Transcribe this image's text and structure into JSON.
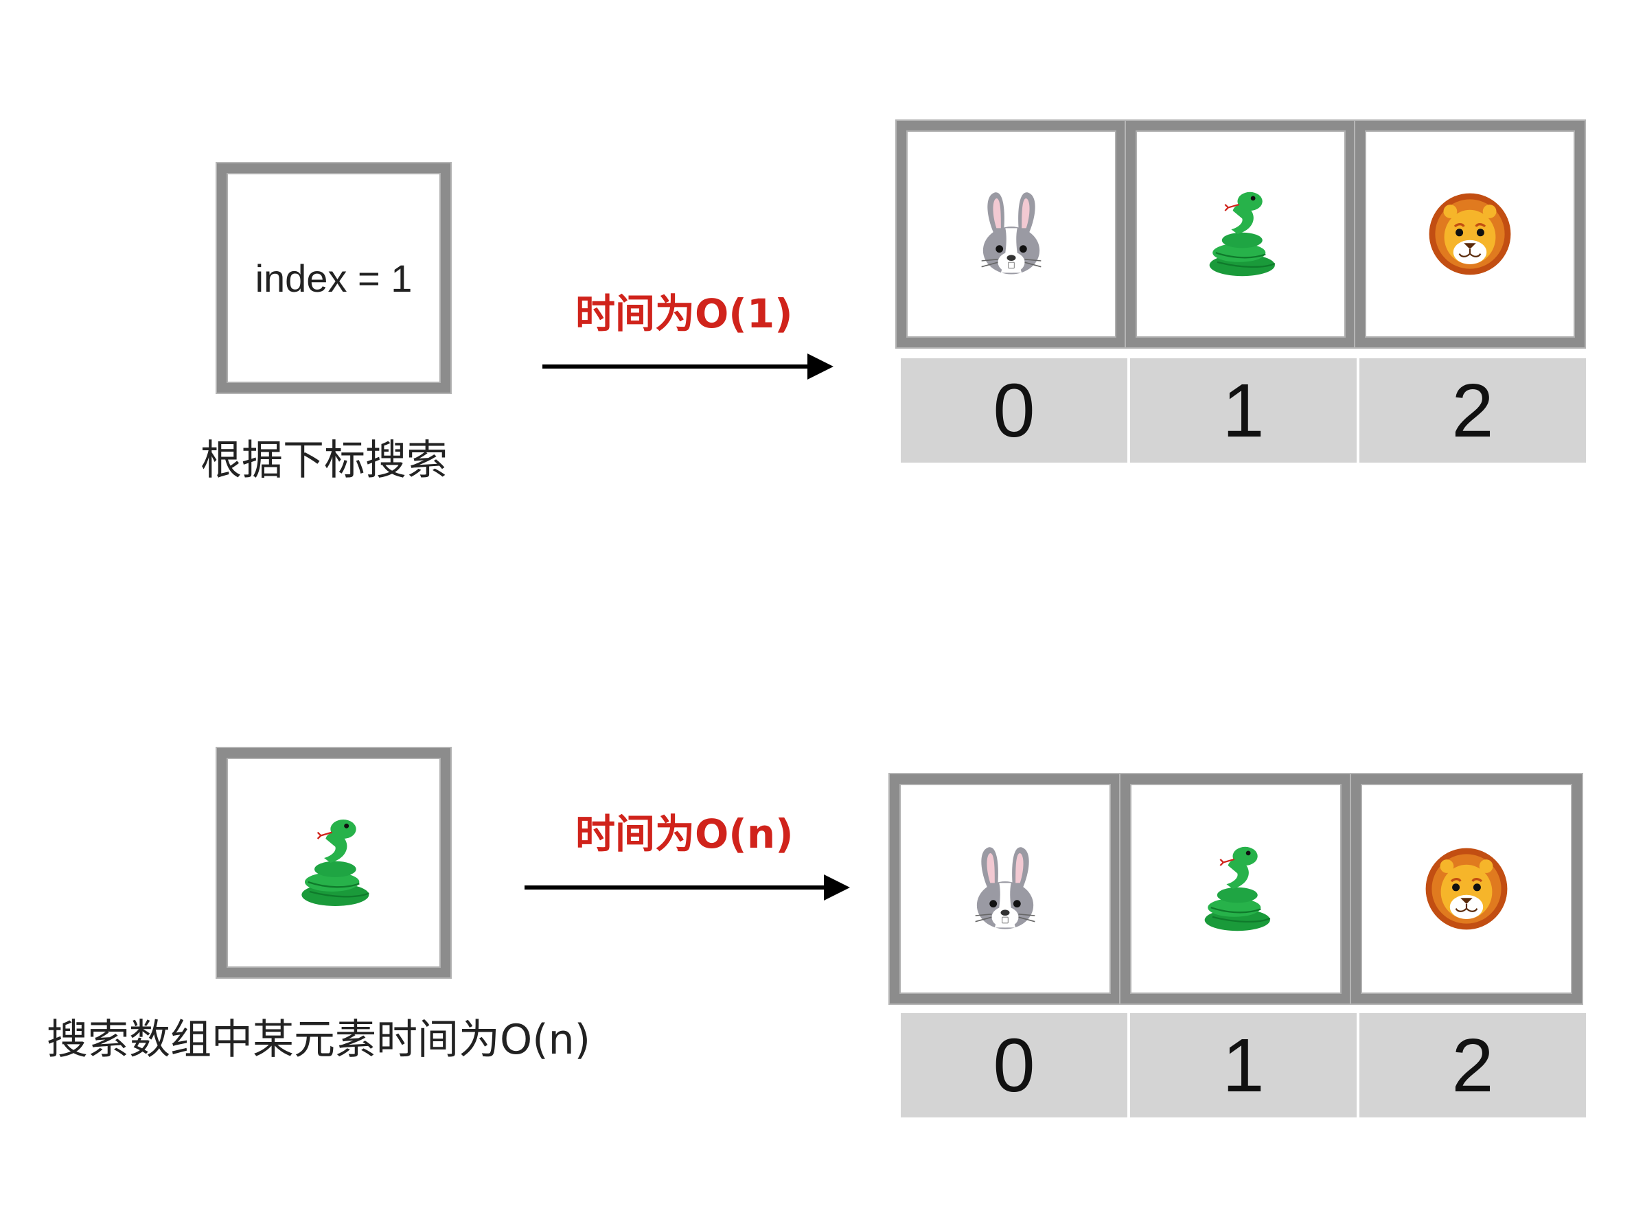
{
  "top": {
    "input_text": "index = 1",
    "caption": "根据下标搜索",
    "time_label": "时间为O(1)",
    "cells": [
      "rabbit-icon",
      "snake-icon",
      "lion-icon"
    ],
    "indices": [
      "0",
      "1",
      "2"
    ]
  },
  "bottom": {
    "input_icon": "snake-icon",
    "caption": "搜索数组中某元素时间为O(n)",
    "time_label": "时间为O(n)",
    "cells": [
      "rabbit-icon",
      "snake-icon",
      "lion-icon"
    ],
    "indices": [
      "0",
      "1",
      "2"
    ]
  },
  "colors": {
    "time_label": "#d0231b",
    "frame_border": "#8c8c8c",
    "index_background": "#d4d4d4"
  }
}
